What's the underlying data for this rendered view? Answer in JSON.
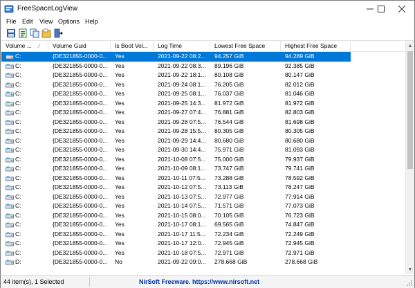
{
  "window": {
    "title": "FreeSpaceLogView"
  },
  "menu": [
    {
      "label": "File"
    },
    {
      "label": "Edit"
    },
    {
      "label": "View"
    },
    {
      "label": "Options"
    },
    {
      "label": "Help"
    }
  ],
  "toolbar": [
    {
      "icon": "save-icon"
    },
    {
      "icon": "html-report-icon"
    },
    {
      "icon": "copy-icon"
    },
    {
      "icon": "properties-icon"
    },
    {
      "icon": "exit-icon"
    }
  ],
  "columns": [
    {
      "label": "Volume ...",
      "sort_glyph": "⁄"
    },
    {
      "label": "Volume Guid"
    },
    {
      "label": "Is Boot Vol..."
    },
    {
      "label": "Log Time"
    },
    {
      "label": "Lowest Free Space"
    },
    {
      "label": "Highest Free Space"
    }
  ],
  "rows": [
    {
      "vol": "C:",
      "guid": "{DE321855-0000-0...",
      "boot": "Yes",
      "time": "2021-09-22 08:2...",
      "low": "94.257 GiB",
      "high": "94.289 GiB",
      "selected": true
    },
    {
      "vol": "C:",
      "guid": "{DE321855-0000-0...",
      "boot": "Yes",
      "time": "2021-09-22 08:3...",
      "low": "89.196 GiB",
      "high": "92.385 GiB"
    },
    {
      "vol": "C:",
      "guid": "{DE321855-0000-0...",
      "boot": "Yes",
      "time": "2021-09-22 18:1...",
      "low": "80.108 GiB",
      "high": "80.147 GiB"
    },
    {
      "vol": "C:",
      "guid": "{DE321855-0000-0...",
      "boot": "Yes",
      "time": "2021-09-24 08:1...",
      "low": "76.205 GiB",
      "high": "82.012 GiB"
    },
    {
      "vol": "C:",
      "guid": "{DE321855-0000-0...",
      "boot": "Yes",
      "time": "2021-09-25 08:1...",
      "low": "76.037 GiB",
      "high": "81.046 GiB"
    },
    {
      "vol": "C:",
      "guid": "{DE321855-0000-0...",
      "boot": "Yes",
      "time": "2021-09-25 14:3...",
      "low": "81.972 GiB",
      "high": "81.972 GiB"
    },
    {
      "vol": "C:",
      "guid": "{DE321855-0000-0...",
      "boot": "Yes",
      "time": "2021-09-27 07:4...",
      "low": "76.881 GiB",
      "high": "82.803 GiB"
    },
    {
      "vol": "C:",
      "guid": "{DE321855-0000-0...",
      "boot": "Yes",
      "time": "2021-09-28 07:5...",
      "low": "76.544 GiB",
      "high": "81.698 GiB"
    },
    {
      "vol": "C:",
      "guid": "{DE321855-0000-0...",
      "boot": "Yes",
      "time": "2021-09-28 15:5...",
      "low": "80.305 GiB",
      "high": "80.305 GiB"
    },
    {
      "vol": "C:",
      "guid": "{DE321855-0000-0...",
      "boot": "Yes",
      "time": "2021-09-29 14:4...",
      "low": "80.680 GiB",
      "high": "80.680 GiB"
    },
    {
      "vol": "C:",
      "guid": "{DE321855-0000-0...",
      "boot": "Yes",
      "time": "2021-09-30 14:4...",
      "low": "75.971 GiB",
      "high": "81.093 GiB"
    },
    {
      "vol": "C:",
      "guid": "{DE321855-0000-0...",
      "boot": "Yes",
      "time": "2021-10-08 07:5...",
      "low": "75.000 GiB",
      "high": "79.937 GiB"
    },
    {
      "vol": "C:",
      "guid": "{DE321855-0000-0...",
      "boot": "Yes",
      "time": "2021-10-09 08:1...",
      "low": "73.747 GiB",
      "high": "79.741 GiB"
    },
    {
      "vol": "C:",
      "guid": "{DE321855-0000-0...",
      "boot": "Yes",
      "time": "2021-10-11 07:5...",
      "low": "73.288 GiB",
      "high": "78.592 GiB"
    },
    {
      "vol": "C:",
      "guid": "{DE321855-0000-0...",
      "boot": "Yes",
      "time": "2021-10-12 07:5...",
      "low": "73.113 GiB",
      "high": "78.247 GiB"
    },
    {
      "vol": "C:",
      "guid": "{DE321855-0000-0...",
      "boot": "Yes",
      "time": "2021-10-13 07:5...",
      "low": "72.977 GiB",
      "high": "77.914 GiB"
    },
    {
      "vol": "C:",
      "guid": "{DE321855-0000-0...",
      "boot": "Yes",
      "time": "2021-10-14 07:5...",
      "low": "71.571 GiB",
      "high": "77.073 GiB"
    },
    {
      "vol": "C:",
      "guid": "{DE321855-0000-0...",
      "boot": "Yes",
      "time": "2021-10-15 08:0...",
      "low": "70.105 GiB",
      "high": "76.723 GiB"
    },
    {
      "vol": "C:",
      "guid": "{DE321855-0000-0...",
      "boot": "Yes",
      "time": "2021-10-17 08:1...",
      "low": "69.565 GiB",
      "high": "74.847 GiB"
    },
    {
      "vol": "C:",
      "guid": "{DE321855-0000-0...",
      "boot": "Yes",
      "time": "2021-10-17 11:5...",
      "low": "72.234 GiB",
      "high": "72.249 GiB"
    },
    {
      "vol": "C:",
      "guid": "{DE321855-0000-0...",
      "boot": "Yes",
      "time": "2021-10-17 12:0...",
      "low": "72.945 GiB",
      "high": "72.945 GiB"
    },
    {
      "vol": "C:",
      "guid": "{DE321855-0000-0...",
      "boot": "Yes",
      "time": "2021-10-18 07:5...",
      "low": "72.971 GiB",
      "high": "72.971 GiB"
    },
    {
      "vol": "D:",
      "guid": "{DE321855-0000-0...",
      "boot": "No",
      "time": "2021-09-22 09:0...",
      "low": "278.668 GiB",
      "high": "278.668 GiB"
    }
  ],
  "status": {
    "count": "44 item(s), 1 Selected",
    "link": "NirSoft Freeware. https://www.nirsoft.net"
  },
  "colors": {
    "selection": "#0078d7",
    "link": "#0033aa"
  }
}
